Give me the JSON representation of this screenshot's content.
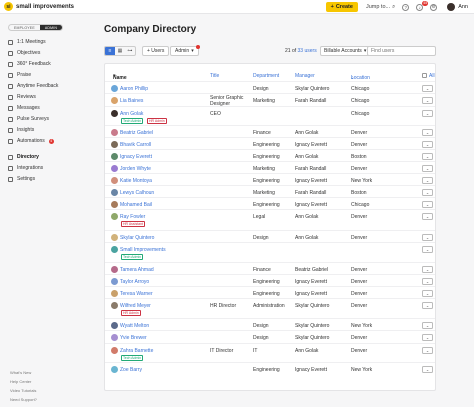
{
  "brand": {
    "name": "small improvements",
    "logo_mark": "si",
    "accent": "#f7c600",
    "link_color": "#3a72d6"
  },
  "topbar": {
    "create_label": "Create",
    "jump_label": "Jump to...",
    "notification_count": "45",
    "user_name": "Ann",
    "icons": [
      "plus-icon",
      "search-icon",
      "help-icon",
      "bell-icon",
      "settings-icon",
      "avatar"
    ]
  },
  "sidebar": {
    "role_toggle": {
      "employee": "EMPLOYEE",
      "admin": "ADMIN"
    },
    "items": [
      {
        "label": "1:1 Meetings",
        "icon": "meetings-icon",
        "badge": ""
      },
      {
        "label": "Objectives",
        "icon": "target-icon",
        "badge": ""
      },
      {
        "label": "360° Feedback",
        "icon": "feedback-icon",
        "badge": ""
      },
      {
        "label": "Praise",
        "icon": "praise-icon",
        "badge": ""
      },
      {
        "label": "Anytime Feedback",
        "icon": "anytime-icon",
        "badge": ""
      },
      {
        "label": "Reviews",
        "icon": "reviews-icon",
        "badge": ""
      },
      {
        "label": "Messages",
        "icon": "messages-icon",
        "badge": ""
      },
      {
        "label": "Pulse Surveys",
        "icon": "pulse-icon",
        "badge": ""
      },
      {
        "label": "Insights",
        "icon": "insights-icon",
        "badge": ""
      },
      {
        "label": "Automations",
        "icon": "automations-icon",
        "badge": "4"
      },
      {
        "label": "Directory",
        "icon": "directory-icon",
        "badge": "",
        "active": true
      },
      {
        "label": "Integrations",
        "icon": "integrations-icon",
        "badge": ""
      },
      {
        "label": "Settings",
        "icon": "settings-icon",
        "badge": ""
      }
    ],
    "footer_links": [
      "What's New",
      "Help Center",
      "Video Tutorials",
      "Need Support?"
    ]
  },
  "page": {
    "title": "Company Directory"
  },
  "toolbar": {
    "users_button": "+ Users",
    "admin_button": "Admin",
    "count_text": "21 of",
    "count_link": "33 users",
    "account_filter": "Billable Accounts",
    "search_placeholder": "Find users"
  },
  "table": {
    "headers": {
      "name": "Name",
      "title": "Title",
      "department": "Department",
      "manager": "Manager",
      "location": "Location",
      "all": "All"
    },
    "rows": [
      {
        "name": "Aaron Phillip",
        "title": "",
        "department": "Design",
        "manager": "Skylar Quintero",
        "location": "Chicago",
        "tag": "",
        "avatar_color": "#6aa6d9"
      },
      {
        "name": "Lia Baines",
        "title": "Senior Graphic Designer",
        "department": "Marketing",
        "manager": "Farah Randall",
        "location": "Chicago",
        "tag": "",
        "avatar_color": "#d9a36a"
      },
      {
        "name": "Ann Golak",
        "title": "CEO",
        "department": "",
        "manager": "",
        "location": "Chicago",
        "tag": "Tech Admin",
        "tag2": "HR Admin",
        "avatar_color": "#3a2f2b"
      },
      {
        "name": "Beatriz Gabriel",
        "title": "",
        "department": "Finance",
        "manager": "Ann Golak",
        "location": "Denver",
        "tag": "",
        "avatar_color": "#c97b8b"
      },
      {
        "name": "Bhavik Carroll",
        "title": "",
        "department": "Engineering",
        "manager": "Ignacy Everett",
        "location": "Denver",
        "tag": "",
        "avatar_color": "#7b6a58"
      },
      {
        "name": "Ignacy Everett",
        "title": "",
        "department": "Engineering",
        "manager": "Ann Golak",
        "location": "Boston",
        "tag": "",
        "avatar_color": "#5d8a6a"
      },
      {
        "name": "Jorden Whyte",
        "title": "",
        "department": "Marketing",
        "manager": "Farah Randall",
        "location": "Denver",
        "tag": "",
        "avatar_color": "#9a7bd1"
      },
      {
        "name": "Katie Montoya",
        "title": "",
        "department": "Engineering",
        "manager": "Ignacy Everett",
        "location": "New York",
        "tag": "",
        "avatar_color": "#d18f7b"
      },
      {
        "name": "Lewys Calhoun",
        "title": "",
        "department": "Marketing",
        "manager": "Farah Randall",
        "location": "Boston",
        "tag": "",
        "avatar_color": "#6a86a6"
      },
      {
        "name": "Mohamed Bail",
        "title": "",
        "department": "Engineering",
        "manager": "Ignacy Everett",
        "location": "Chicago",
        "tag": "",
        "avatar_color": "#a67b5b"
      },
      {
        "name": "Ray Fowler",
        "title": "",
        "department": "Legal",
        "manager": "Ann Golak",
        "location": "Denver",
        "tag": "HR Assistant",
        "avatar_color": "#8fa86a"
      },
      {
        "name": "Skylar Quintero",
        "title": "",
        "department": "Design",
        "manager": "Ann Golak",
        "location": "Denver",
        "tag": "",
        "avatar_color": "#d1b27b"
      },
      {
        "name": "Small Improvements",
        "title": "",
        "department": "",
        "manager": "",
        "location": "",
        "tag": "Tech Admin",
        "avatar_color": "#4aa3a0"
      },
      {
        "name": "Tamera Ahmad",
        "title": "",
        "department": "Finance",
        "manager": "Beatriz Gabriel",
        "location": "Denver",
        "tag": "",
        "avatar_color": "#b56a8a"
      },
      {
        "name": "Taylor Arroyo",
        "title": "",
        "department": "Engineering",
        "manager": "Ignacy Everett",
        "location": "Denver",
        "tag": "",
        "avatar_color": "#7b9ad1"
      },
      {
        "name": "Teresa Warner",
        "title": "",
        "department": "Engineering",
        "manager": "Ignacy Everett",
        "location": "Denver",
        "tag": "",
        "avatar_color": "#c9a06a"
      },
      {
        "name": "Wilfred Meyer",
        "title": "HR Director",
        "department": "Administration",
        "manager": "Skylar Quintero",
        "location": "Denver",
        "tag": "HR Admin",
        "avatar_color": "#8a7b6a"
      },
      {
        "name": "Wyatt Melton",
        "title": "",
        "department": "Design",
        "manager": "Skylar Quintero",
        "location": "New York",
        "tag": "",
        "avatar_color": "#5b6a8a"
      },
      {
        "name": "Yvie Brewer",
        "title": "",
        "department": "Design",
        "manager": "Skylar Quintero",
        "location": "Denver",
        "tag": "",
        "avatar_color": "#a68fd1"
      },
      {
        "name": "Zahra Barnette",
        "title": "IT Director",
        "department": "IT",
        "manager": "Ann Golak",
        "location": "Denver",
        "tag": "Tech Admin",
        "avatar_color": "#d17b6a"
      },
      {
        "name": "Zoe Barry",
        "title": "",
        "department": "Engineering",
        "manager": "Ignacy Everett",
        "location": "New York",
        "tag": "",
        "avatar_color": "#6ab5d1"
      }
    ]
  }
}
